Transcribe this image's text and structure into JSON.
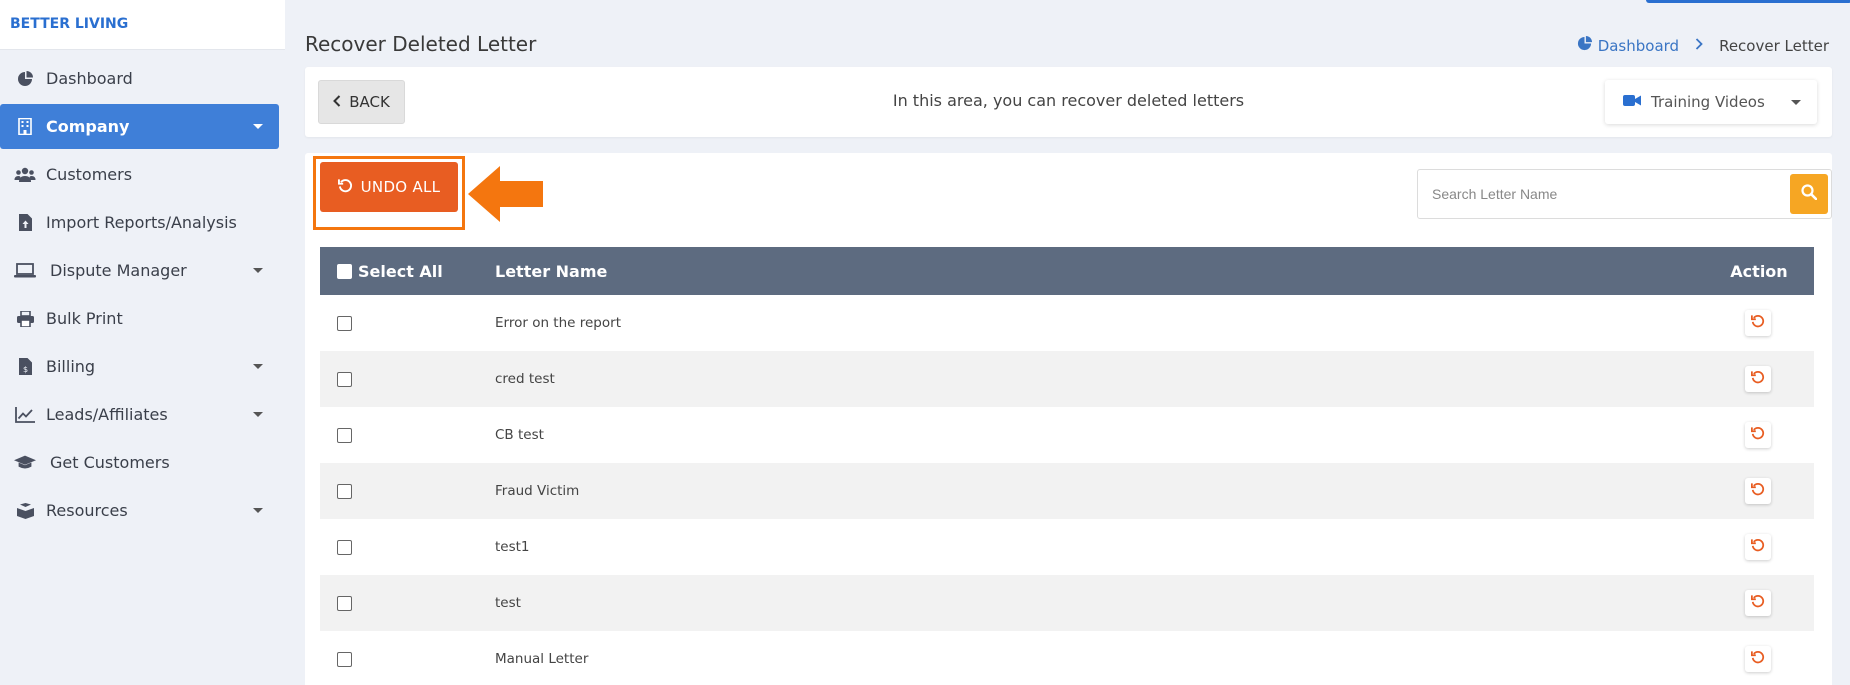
{
  "brand": "BETTER LIVING",
  "sidebar": {
    "items": [
      {
        "label": "Dashboard",
        "icon": "pie-chart-icon"
      },
      {
        "label": "Company",
        "icon": "building-icon",
        "active": true
      },
      {
        "label": "Customers",
        "icon": "users-icon"
      },
      {
        "label": "Import Reports/Analysis",
        "icon": "file-upload-icon"
      },
      {
        "label": "Dispute Manager",
        "icon": "laptop-icon"
      },
      {
        "label": "Bulk Print",
        "icon": "printer-icon"
      },
      {
        "label": "Billing",
        "icon": "invoice-icon"
      },
      {
        "label": "Leads/Affiliates",
        "icon": "line-chart-icon"
      },
      {
        "label": "Get Customers",
        "icon": "graduation-cap-icon"
      },
      {
        "label": "Resources",
        "icon": "box-icon"
      }
    ]
  },
  "header": {
    "title": "Recover Deleted Letter",
    "breadcrumb": {
      "home": "Dashboard",
      "current": "Recover Letter"
    }
  },
  "info_panel": {
    "back_label": "BACK",
    "text": "In this area, you can recover deleted letters",
    "training_label": "Training Videos"
  },
  "toolbar": {
    "undo_all_label": "UNDO ALL",
    "search_placeholder": "Search Letter Name"
  },
  "table": {
    "columns": {
      "select": "Select All",
      "name": "Letter Name",
      "action": "Action"
    },
    "rows": [
      {
        "name": "Error on the report"
      },
      {
        "name": "cred test"
      },
      {
        "name": "CB test"
      },
      {
        "name": "Fraud Victim"
      },
      {
        "name": "test1"
      },
      {
        "name": "test"
      },
      {
        "name": "Manual Letter"
      }
    ]
  },
  "colors": {
    "accent": "#3f7fd8",
    "undo": "#e85d22",
    "annotation": "#f4760f",
    "search_button": "#f6a623",
    "table_header": "#5d6b80"
  }
}
